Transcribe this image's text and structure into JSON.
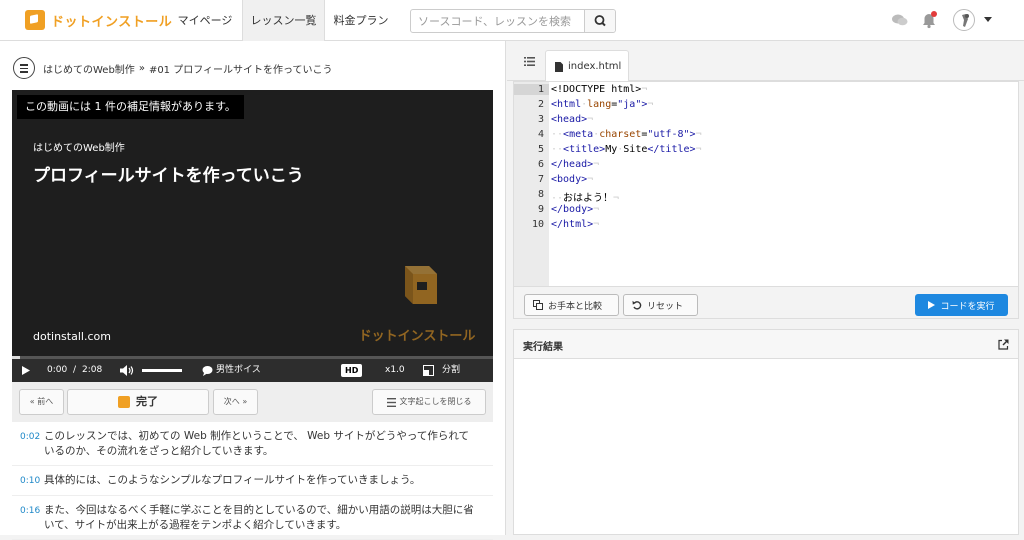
{
  "header": {
    "logo_text": "ドットインストール",
    "nav": [
      {
        "label": "マイページ",
        "active": false
      },
      {
        "label": "レッスン一覧",
        "active": true
      },
      {
        "label": "料金プラン",
        "active": false
      }
    ],
    "search_placeholder": "ソースコード、レッスンを検索",
    "icons": [
      "chat-icon",
      "bell-icon",
      "avatar",
      "chevron-down-icon"
    ],
    "brand_color": "#f0a024",
    "notification_color": "#e23b3b"
  },
  "breadcrumb": {
    "series": "はじめてのWeb制作",
    "separator": "»",
    "lesson": "#01 プロフィールサイトを作っていこう"
  },
  "video": {
    "notice": "この動画には 1 件の補足情報があります。",
    "series": "はじめてのWeb制作",
    "title": "プロフィールサイトを作っていこう",
    "site": "dotinstall.com",
    "brand": "ドットインストール",
    "progress": 0.0,
    "controls": {
      "current_time": "0:00",
      "separator": "/",
      "duration": "2:08",
      "voice_label": "男性ボイス",
      "hd_label": "HD",
      "speed": "x1.0",
      "split_label": "分割"
    }
  },
  "lesson_nav": {
    "prev": "« 前へ",
    "complete": "完了",
    "next": "次へ »",
    "close_transcript": "文字起こしを閉じる"
  },
  "transcript": [
    {
      "time": "0:02",
      "text": "このレッスンでは、初めての Web 制作ということで、 Web サイトがどうやって作られているのか、その流れをざっと紹介していきます。"
    },
    {
      "time": "0:10",
      "text": "具体的には、このようなシンプルなプロフィールサイトを作っていきましょう。"
    },
    {
      "time": "0:16",
      "text": "また、今回はなるべく手軽に学ぶことを目的としているので、細かい用語の説明は大胆に省いて、サイトが出来上がる過程をテンポよく紹介していきます。"
    }
  ],
  "editor": {
    "file_tab": "index.html",
    "active_line": 1,
    "line_numbers": [
      "1",
      "2",
      "3",
      "4",
      "5",
      "6",
      "7",
      "8",
      "9",
      "10"
    ],
    "buttons": {
      "compare": "お手本と比較",
      "reset": "リセット",
      "run": "コードを実行"
    }
  },
  "result": {
    "title": "実行結果"
  }
}
